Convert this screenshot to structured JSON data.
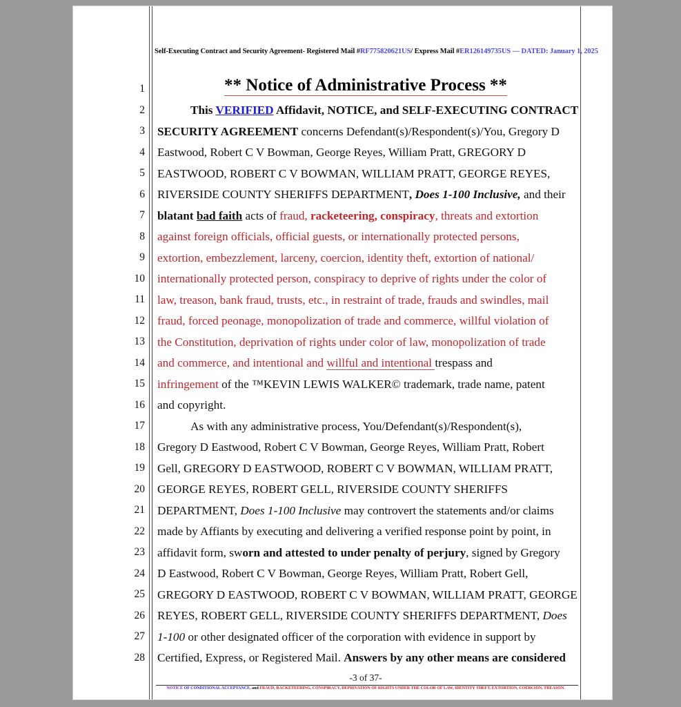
{
  "document": {
    "header": {
      "prefix": "Self-Executing Contract and Security Agreement- Registered Mail #",
      "registered_mail_number": "RF775820621US",
      "middle": "/ Express Mail #",
      "express_mail_number": "ER126149735US",
      "dated": "  — DATED: January 1, 2025"
    },
    "title": "** Notice of Administrative Process **",
    "line_numbers": [
      1,
      2,
      3,
      4,
      5,
      6,
      7,
      8,
      9,
      10,
      11,
      12,
      13,
      14,
      15,
      16,
      17,
      18,
      19,
      20,
      21,
      22,
      23,
      24,
      25,
      26,
      27,
      28
    ],
    "lines": [
      {
        "n": 1,
        "text": ""
      },
      {
        "n": 2,
        "text": "This VERIFIED Affidavit, NOTICE, and SELF-EXECUTING CONTRACT"
      },
      {
        "n": 3,
        "text": "SECURITY AGREEMENT concerns Defendant(s)/Respondent(s)/You, Gregory D"
      },
      {
        "n": 4,
        "text": "Eastwood, Robert C V Bowman, George Reyes, William Pratt, GREGORY D"
      },
      {
        "n": 5,
        "text": "EASTWOOD, ROBERT C V BOWMAN, WILLIAM PRATT, GEORGE REYES,"
      },
      {
        "n": 6,
        "text": "RIVERSIDE COUNTY SHERIFFS DEPARTMENT, Does 1-100 Inclusive, and their"
      },
      {
        "n": 7,
        "text": "blatant bad faith acts of fraud, racketeering, conspiracy, threats and extortion"
      },
      {
        "n": 8,
        "text": "against foreign officials, official guests, or internationally protected persons,"
      },
      {
        "n": 9,
        "text": "extortion, embezzlement, larceny, coercion, identity theft, extortion of national/"
      },
      {
        "n": 10,
        "text": "internationally protected person, conspiracy to deprive of rights under the color of"
      },
      {
        "n": 11,
        "text": "law, treason, bank fraud, trusts, etc., in restraint of trade, frauds and swindles, mail"
      },
      {
        "n": 12,
        "text": "fraud, forced peonage, monopolization of trade and commerce, willful violation of"
      },
      {
        "n": 13,
        "text": "the Constitution, deprivation of rights under color of law, monopolization of trade"
      },
      {
        "n": 14,
        "text": "and commerce, and intentional and willful and intentional trespass and"
      },
      {
        "n": 15,
        "text": "infringement of the ™KEVIN LEWIS WALKER© trademark, trade name, patent"
      },
      {
        "n": 16,
        "text": "and copyright."
      },
      {
        "n": 17,
        "text": "As with any administrative process, You/Defendant(s)/Respondent(s),"
      },
      {
        "n": 18,
        "text": "Gregory D Eastwood, Robert C V Bowman, George Reyes, William Pratt, Robert"
      },
      {
        "n": 19,
        "text": "Gell, GREGORY D EASTWOOD, ROBERT C V BOWMAN, WILLIAM PRATT,"
      },
      {
        "n": 20,
        "text": "GEORGE REYES, ROBERT GELL, RIVERSIDE COUNTY SHERIFFS"
      },
      {
        "n": 21,
        "text": "DEPARTMENT, Does 1-100 Inclusive may controvert the statements and/or claims"
      },
      {
        "n": 22,
        "text": "made by Affiants by executing and delivering a verified response point by point, in"
      },
      {
        "n": 23,
        "text": "affidavit form, sworn and attested to under penalty of perjury, signed by Gregory"
      },
      {
        "n": 24,
        "text": "D Eastwood, Robert C V Bowman, George Reyes, William Pratt, Robert Gell,"
      },
      {
        "n": 25,
        "text": "GREGORY D EASTWOOD, ROBERT C V BOWMAN, WILLIAM PRATT, GEORGE"
      },
      {
        "n": 26,
        "text": "REYES, ROBERT GELL, RIVERSIDE COUNTY SHERIFFS DEPARTMENT, Does"
      },
      {
        "n": 27,
        "text": "1-100 or other designated officer of the corporation with evidence in support by"
      },
      {
        "n": 28,
        "text": "Certified, Express, or Registered Mail. Answers by any other means are considered"
      }
    ],
    "footer": {
      "page_label": "-3 of 37-",
      "notice_word": "NOTICE",
      "conditional_acceptance": " OF CONDITIONAL ACCEPTANCE,",
      "and_word": " and ",
      "offenses": "FRAUD, RACKETEERING, CONSPIRACY, DEPRIVATION OF RIGHTS UNDER THE COLOR OF LAW, IDENTITY THEFT, EXTORTION, COERCION, TREASON."
    },
    "colors": {
      "red": "#c0272d",
      "blue": "#1b1bd6",
      "header_blue": "#4a4ae0",
      "purple": "#7d2fd0",
      "page_background": "#999999",
      "paper": "#ffffff"
    }
  }
}
